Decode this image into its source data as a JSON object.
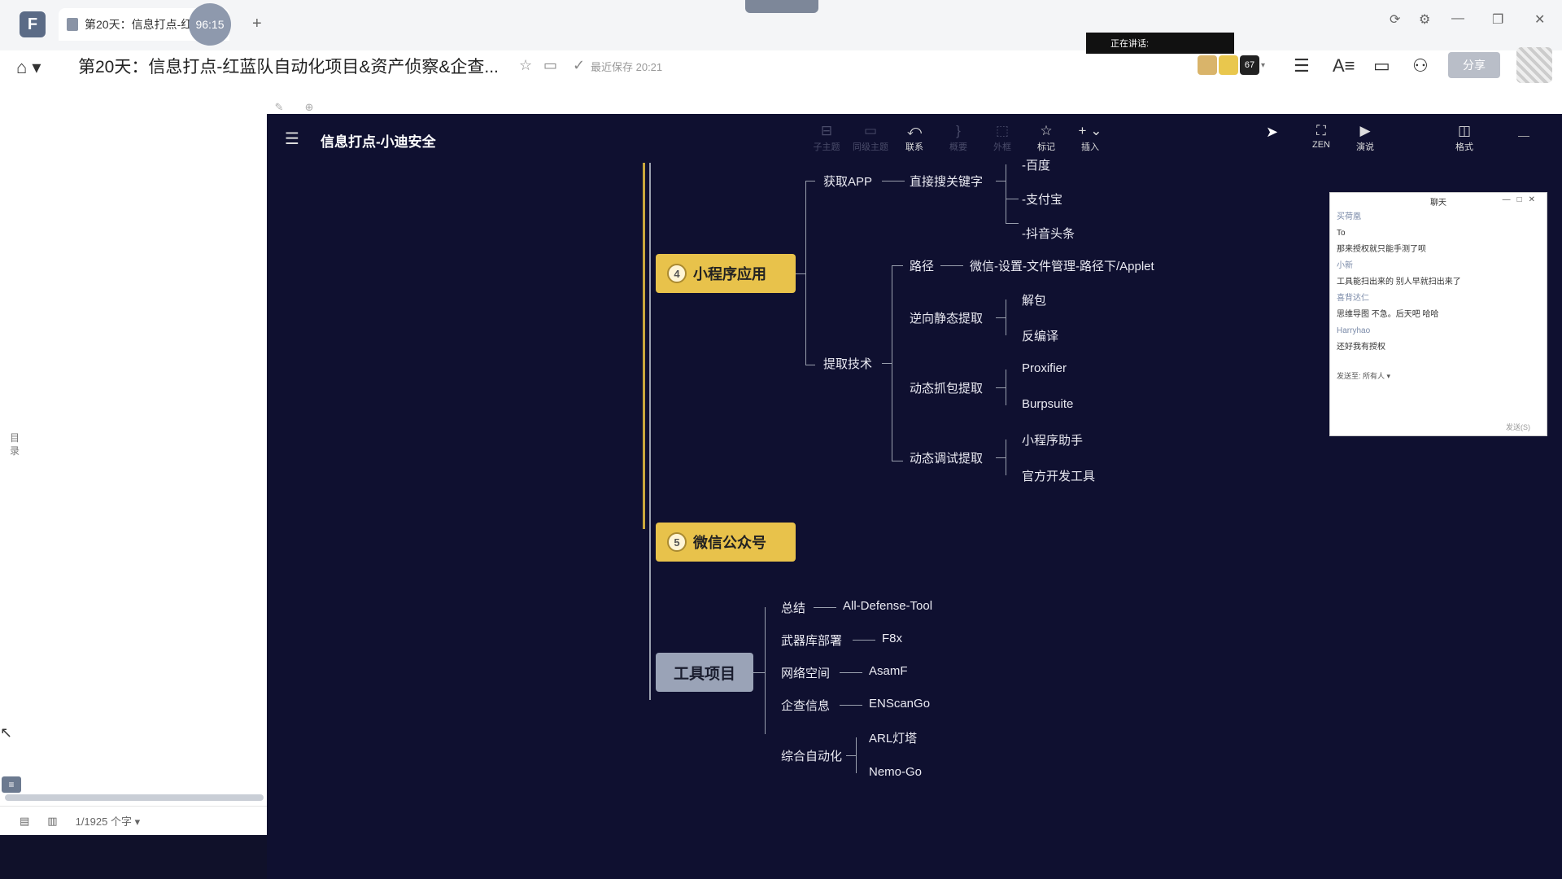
{
  "app": {
    "tab_title": "第20天：信息打点-红",
    "timer": "96:15",
    "new_tab": "+",
    "doc_title": "第20天：信息打点-红蓝队自动化项目&资产侦察&企查...",
    "saved_text": "最近保存 20:21",
    "speaking": "正在讲话:",
    "participant_count": "67",
    "share_label": "分享"
  },
  "sidebar": {
    "toc_label": "目录",
    "word_count": "1/1925 个字 ▾"
  },
  "mindmap": {
    "title": "信息打点-小迪安全",
    "tools": [
      {
        "icon": "⤺",
        "label": "联系"
      },
      {
        "icon": "☆",
        "label": "标记"
      },
      {
        "icon": "+ ⌄",
        "label": "插入"
      },
      {
        "icon": "⛶",
        "label": "ZEN"
      },
      {
        "icon": "▶",
        "label": "演说"
      },
      {
        "icon": "◫",
        "label": "格式"
      }
    ],
    "dim_tools": [
      "子主题",
      "同级主题",
      "概要",
      "外框"
    ],
    "nodes": {
      "baidu": "-百度",
      "get_app": "获取APP",
      "search_kw": "直接搜关键字",
      "alipay": "-支付宝",
      "douyin": "-抖音头条",
      "mini_program": "小程序应用",
      "mini_num": "4",
      "path": "路径",
      "path_val": "微信-设置-文件管理-路径下/Applet",
      "reverse": "逆向静态提取",
      "unpack": "解包",
      "decompile": "反编译",
      "extract_tech": "提取技术",
      "dyn_capture": "动态抓包提取",
      "proxifier": "Proxifier",
      "burpsuite": "Burpsuite",
      "dyn_debug": "动态调试提取",
      "mini_helper": "小程序助手",
      "official_tool": "官方开发工具",
      "wechat_oa": "微信公众号",
      "wechat_num": "5",
      "tool_project": "工具项目",
      "summary": "总结",
      "all_defense": "All-Defense-Tool",
      "arsenal": "武器库部署",
      "f8x": "F8x",
      "cyberspace": "网络空间",
      "asamf": "AsamF",
      "enterprise": "企查信息",
      "enscango": "ENScanGo",
      "auto": "综合自动化",
      "arl": "ARL灯塔",
      "nemo": "Nemo-Go"
    }
  },
  "chat": {
    "title": "聊天",
    "messages": [
      {
        "name": "买荷凰",
        "text": "To"
      },
      {
        "name": "",
        "text": "那来授权就只能手测了呗"
      },
      {
        "name": "小新",
        "text": "工具能扫出来的 别人早就扫出来了"
      },
      {
        "name": "喜背达仁",
        "text": "思维导图 不急。后天吧 哈哈"
      },
      {
        "name": "Harryhao",
        "text": "还好我有授权"
      }
    ],
    "send_to_label": "发送至:",
    "send_to_value": "所有人 ▾",
    "send_btn": "发送(S)"
  }
}
